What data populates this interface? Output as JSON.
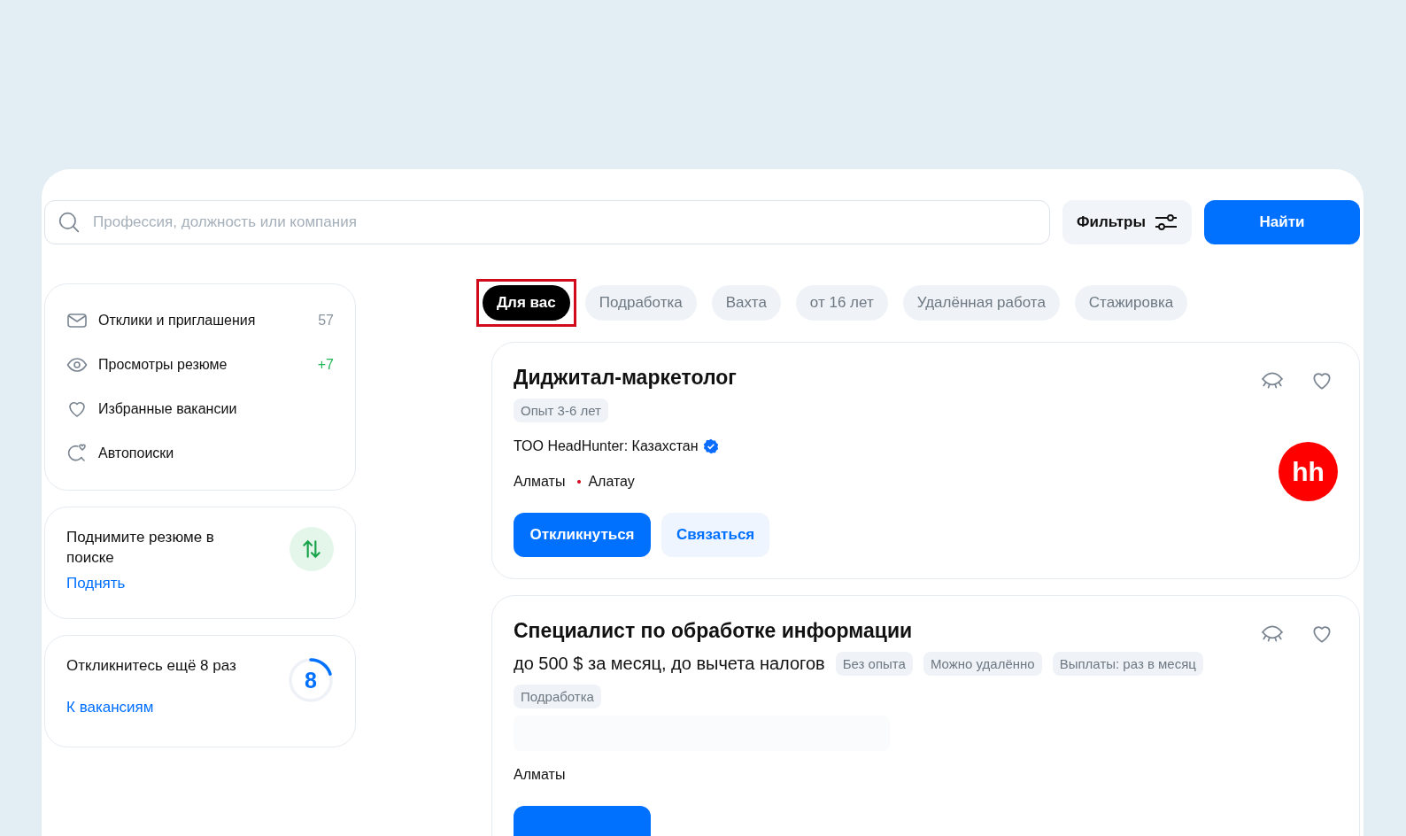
{
  "search": {
    "placeholder": "Профессия, должность или компания"
  },
  "filters_button": "Фильтры",
  "find_button": "Найти",
  "sidebar": {
    "menu": [
      {
        "label": "Отклики и приглашения",
        "count": "57",
        "color": "#8a949e"
      },
      {
        "label": "Просмотры резюме",
        "count": "+7",
        "color": "#1fb75a"
      },
      {
        "label": "Избранные вакансии"
      },
      {
        "label": "Автопоиски"
      }
    ],
    "promo": {
      "title": "Поднимите резюме в поиске",
      "link": "Поднять"
    },
    "responses": {
      "title": "Откликнитесь ещё 8 раз",
      "counter": "8",
      "level": 0.2,
      "link": "К вакансиям"
    }
  },
  "chips": [
    {
      "label": "Для вас",
      "selected": true,
      "highlighted": true
    },
    {
      "label": "Подработка",
      "selected": false,
      "highlighted": false
    },
    {
      "label": "Вахта",
      "selected": false,
      "highlighted": false
    },
    {
      "label": "от 16 лет",
      "selected": false,
      "highlighted": false
    },
    {
      "label": "Удалённая работа",
      "selected": false,
      "highlighted": false
    },
    {
      "label": "Стажировка",
      "selected": false,
      "highlighted": false
    }
  ],
  "vacancies": [
    {
      "title": "Диджитал-маркетолог",
      "tags": [
        "Опыт 3-6 лет"
      ],
      "company": "ТОО HeadHunter: Казахстан",
      "verified": true,
      "location": "Алматы",
      "district": {
        "name": "Алатау",
        "color": "#d6001c"
      },
      "logo": "hh",
      "loading": false,
      "buttons": [
        {
          "label": "Откликнуться",
          "kind": "primary"
        },
        {
          "label": "Связаться",
          "kind": "secondary"
        }
      ]
    },
    {
      "title": "Специалист по обработке информации",
      "salary": "до 500 $ за месяц, до вычета налогов",
      "tags": [
        "Без опыта",
        "Можно удалённо",
        "Выплаты: раз в месяц",
        "Подработка"
      ],
      "location": "Алматы",
      "loading": true,
      "buttons": [
        {
          "kind": "primary"
        }
      ]
    }
  ]
}
